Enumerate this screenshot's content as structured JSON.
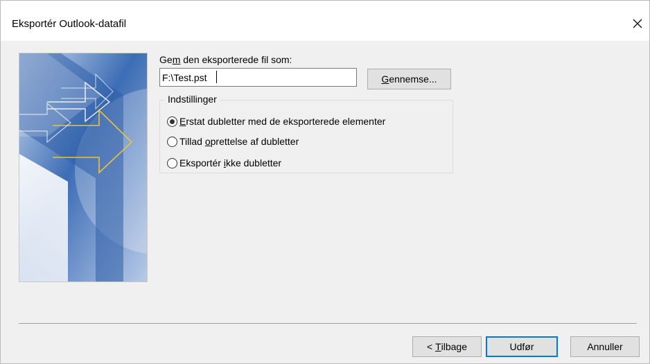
{
  "window": {
    "title": "Eksportér Outlook-datafil"
  },
  "save_as": {
    "label_pre": "Ge",
    "label_mnemonic": "m",
    "label_post": " den eksporterede fil som:",
    "path_value": "F:\\Test.pst"
  },
  "browse_button": {
    "mnemonic": "G",
    "rest": "ennemse..."
  },
  "options": {
    "legend": "Indstillinger",
    "items": [
      {
        "pre": "",
        "mnemonic": "E",
        "post": "rstat dubletter med de eksporterede elementer",
        "selected": true
      },
      {
        "pre": "Tillad ",
        "mnemonic": "o",
        "post": "prettelse af dubletter",
        "selected": false
      },
      {
        "pre": "Eksportér ",
        "mnemonic": "i",
        "post": "kke dubletter",
        "selected": false
      }
    ]
  },
  "buttons": {
    "back": {
      "pre": "< ",
      "mnemonic": "T",
      "post": "ilbage"
    },
    "finish": {
      "label": "Udfør"
    },
    "cancel": {
      "label": "Annuller"
    }
  },
  "icons": {
    "close": "close-icon",
    "wizard": "wizard-arrows-graphic"
  },
  "colors": {
    "accent": "#0078d7",
    "image_blue": "#3e6fb7",
    "arrow_yellow": "#e8c53a"
  }
}
